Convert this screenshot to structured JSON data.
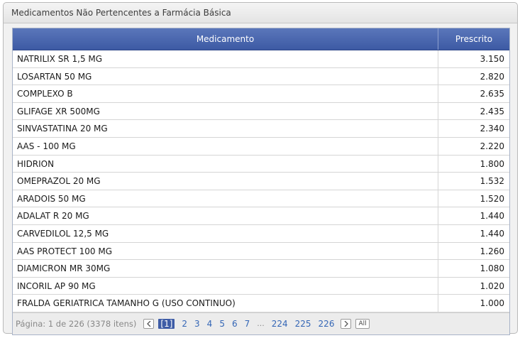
{
  "panel": {
    "title": "Medicamentos Não Pertencentes a Farmácia Básica"
  },
  "table": {
    "headers": {
      "medicamento": "Medicamento",
      "prescrito": "Prescrito"
    },
    "rows": [
      {
        "medicamento": "NATRILIX SR 1,5 MG",
        "prescrito": "3.150"
      },
      {
        "medicamento": "LOSARTAN 50 MG",
        "prescrito": "2.820"
      },
      {
        "medicamento": "COMPLEXO B",
        "prescrito": "2.635"
      },
      {
        "medicamento": "GLIFAGE XR 500MG",
        "prescrito": "2.435"
      },
      {
        "medicamento": "SINVASTATINA 20 MG",
        "prescrito": "2.340"
      },
      {
        "medicamento": "AAS - 100 MG",
        "prescrito": "2.220"
      },
      {
        "medicamento": "HIDRION",
        "prescrito": "1.800"
      },
      {
        "medicamento": "OMEPRAZOL 20 MG",
        "prescrito": "1.532"
      },
      {
        "medicamento": "ARADOIS 50 MG",
        "prescrito": "1.520"
      },
      {
        "medicamento": "ADALAT R 20 MG",
        "prescrito": "1.440"
      },
      {
        "medicamento": "CARVEDILOL 12,5 MG",
        "prescrito": "1.440"
      },
      {
        "medicamento": "AAS PROTECT 100 MG",
        "prescrito": "1.260"
      },
      {
        "medicamento": "DIAMICRON MR 30MG",
        "prescrito": "1.080"
      },
      {
        "medicamento": "INCORIL AP 90 MG",
        "prescrito": "1.020"
      },
      {
        "medicamento": "FRALDA GERIATRICA TAMANHO G (USO CONTINUO)",
        "prescrito": "1.000"
      }
    ]
  },
  "pager": {
    "info": "Página: 1 de 226 (3378 itens)",
    "prev_icon": "chevron-left-icon",
    "next_icon": "chevron-right-icon",
    "current": "[1]",
    "pages": [
      "2",
      "3",
      "4",
      "5",
      "6",
      "7"
    ],
    "ellipsis": "...",
    "last_pages": [
      "224",
      "225",
      "226"
    ],
    "all_label": "All"
  }
}
